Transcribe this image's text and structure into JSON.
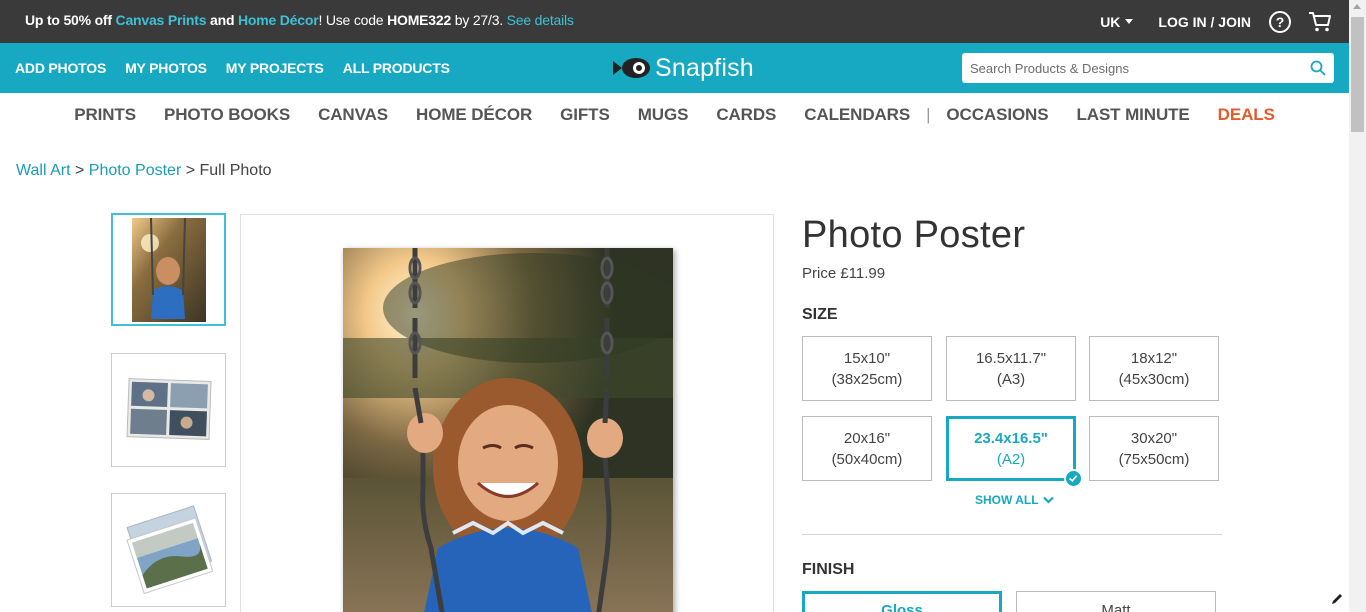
{
  "promo": {
    "part1": "Up to 50% off ",
    "link1": "Canvas Prints",
    "part2": " and ",
    "link2": "Home Décor",
    "part3": "! Use code ",
    "code": "HOME322",
    "part4": " by 27/3. ",
    "details": "See details"
  },
  "account": {
    "region": "UK",
    "login": "LOG IN / JOIN",
    "help": "?"
  },
  "topnav": {
    "items": [
      "ADD PHOTOS",
      "MY PHOTOS",
      "MY PROJECTS",
      "ALL PRODUCTS"
    ],
    "logo": "Snapfish",
    "search_placeholder": "Search Products & Designs"
  },
  "categories": {
    "left": [
      "PRINTS",
      "PHOTO BOOKS",
      "CANVAS",
      "HOME DÉCOR",
      "GIFTS",
      "MUGS",
      "CARDS",
      "CALENDARS"
    ],
    "separator": "|",
    "right": [
      "OCCASIONS",
      "LAST MINUTE"
    ],
    "deals": "DEALS",
    "deals_color": "#e45a2a"
  },
  "breadcrumb": {
    "item1": "Wall Art",
    "sep": " > ",
    "item2": "Photo Poster",
    "current": "Full Photo"
  },
  "product": {
    "title": "Photo Poster",
    "price": "Price £11.99",
    "size_label": "SIZE",
    "sizes": [
      {
        "l1": "15x10\"",
        "l2": "(38x25cm)"
      },
      {
        "l1": "16.5x11.7\"",
        "l2": "(A3)"
      },
      {
        "l1": "18x12\"",
        "l2": "(45x30cm)"
      },
      {
        "l1": "20x16\"",
        "l2": "(50x40cm)"
      },
      {
        "l1": "23.4x16.5\"",
        "l2": "(A2)"
      },
      {
        "l1": "30x20\"",
        "l2": "(75x50cm)"
      }
    ],
    "selected_size_index": 4,
    "show_all": "SHOW ALL",
    "finish_label": "FINISH",
    "finishes": [
      "Gloss",
      "Matt"
    ]
  },
  "colors": {
    "teal": "#17a9c1",
    "dark_bar": "#3a3a3a",
    "link": "#1a9cb5"
  }
}
